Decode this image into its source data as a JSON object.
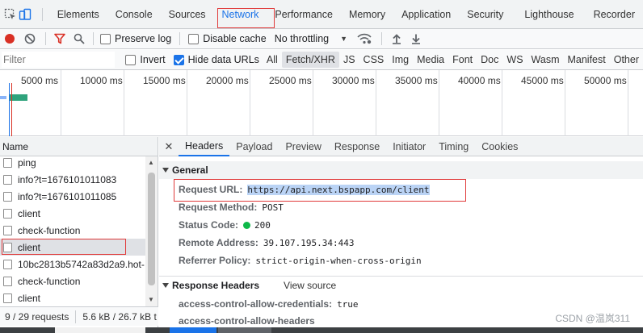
{
  "tabbar": {
    "tabs": [
      "Elements",
      "Console",
      "Sources",
      "Network",
      "Performance",
      "Memory",
      "Application",
      "Security",
      "Lighthouse",
      "Recorder"
    ],
    "active_tab": "Network"
  },
  "toolbar": {
    "preserve_log": "Preserve log",
    "disable_cache": "Disable cache",
    "throttling": "No throttling"
  },
  "filterbar": {
    "placeholder": "Filter",
    "invert": "Invert",
    "hide_data_urls": "Hide data URLs",
    "types": [
      "All",
      "Fetch/XHR",
      "JS",
      "CSS",
      "Img",
      "Media",
      "Font",
      "Doc",
      "WS",
      "Wasm",
      "Manifest",
      "Other"
    ],
    "active_type": "Fetch/XHR"
  },
  "overview": {
    "ticks": [
      "5000 ms",
      "10000 ms",
      "15000 ms",
      "20000 ms",
      "25000 ms",
      "30000 ms",
      "35000 ms",
      "40000 ms",
      "45000 ms",
      "50000 ms"
    ]
  },
  "requests": {
    "header": "Name",
    "items": [
      "ping",
      "info?t=1676101011083",
      "info?t=1676101011085",
      "client",
      "check-function",
      "client",
      "10bc2813b5742a83d2a9.hot-",
      "check-function",
      "client"
    ],
    "selected_index": 5,
    "status_requests": "9 / 29 requests",
    "status_size": "5.6 kB / 26.7 kB t"
  },
  "detail": {
    "tabs": [
      "Headers",
      "Payload",
      "Preview",
      "Response",
      "Initiator",
      "Timing",
      "Cookies"
    ],
    "active_tab": "Headers",
    "general_title": "General",
    "general": [
      {
        "key": "Request URL:",
        "value": "https://api.next.bspapp.com/client"
      },
      {
        "key": "Request Method:",
        "value": "POST"
      },
      {
        "key": "Status Code:",
        "value": "200"
      },
      {
        "key": "Remote Address:",
        "value": "39.107.195.34:443"
      },
      {
        "key": "Referrer Policy:",
        "value": "strict-origin-when-cross-origin"
      }
    ],
    "response_headers_title": "Response Headers",
    "view_source": "View source",
    "response_headers": [
      {
        "key": "access-control-allow-credentials:",
        "value": "true"
      },
      {
        "key": "access-control-allow-headers",
        "value": ""
      }
    ]
  },
  "watermark": "CSDN @温岚311",
  "colors": {
    "accent": "#1a73e8",
    "highlight": "#e03a3a",
    "status_ok": "#0fb849",
    "record": "#d93025"
  }
}
